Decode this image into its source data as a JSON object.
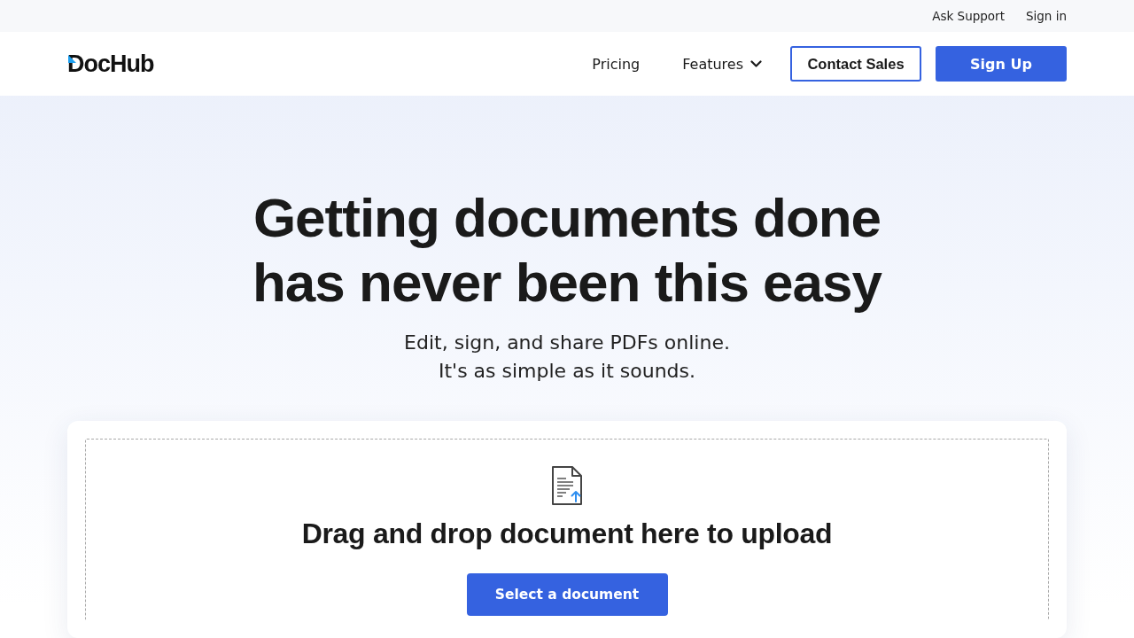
{
  "top_bar": {
    "links": [
      "Ask Support",
      "Sign in"
    ]
  },
  "nav": {
    "logo": "DocHub",
    "links": [
      {
        "label": "Pricing",
        "kind": "link"
      },
      {
        "label": "Features",
        "kind": "dropdown"
      }
    ],
    "buttons": [
      {
        "label": "Contact Sales",
        "kind": "outline"
      },
      {
        "label": "Sign Up",
        "kind": "solid"
      }
    ]
  },
  "hero": {
    "headline": [
      "Getting documents done",
      "has never been this easy"
    ],
    "subtitle": [
      "Edit, sign, and share PDFs online.",
      "It's as simple as it sounds."
    ]
  },
  "upload": {
    "heading": "Drag and drop document here to upload",
    "button": "Select a document"
  }
}
